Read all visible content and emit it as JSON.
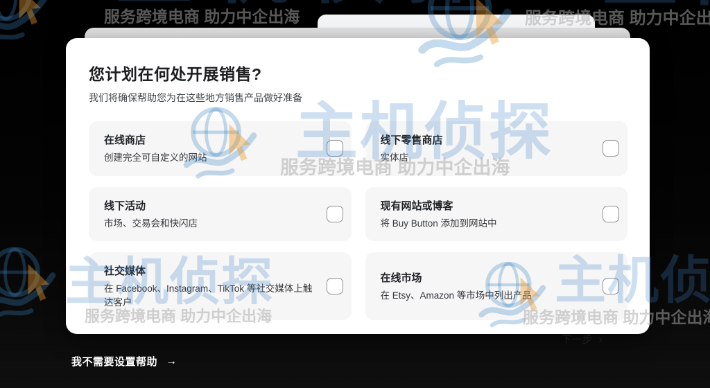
{
  "modal": {
    "title": "您计划在何处开展销售?",
    "subtitle": "我们将确保帮助您为在这些地方销售产品做好准备",
    "options": [
      {
        "title": "在线商店",
        "description": "创建完全可自定义的网站",
        "checked": false
      },
      {
        "title": "线下零售商店",
        "description": "实体店",
        "checked": false
      },
      {
        "title": "线下活动",
        "description": "市场、交易会和快闪店",
        "checked": false
      },
      {
        "title": "现有网站或博客",
        "description": "将 Buy Button 添加到网站中",
        "checked": false
      },
      {
        "title": "社交媒体",
        "description": "在 Facebook、Instagram、TikTok 等社交媒体上触达客户",
        "checked": false
      },
      {
        "title": "在线市场",
        "description": "在 Etsy、Amazon 等市场中列出产品",
        "checked": false
      }
    ],
    "next_label": "下一步",
    "next_chevron": "›"
  },
  "footer": {
    "skip_label": "我不需要设置帮助",
    "skip_arrow": "→"
  },
  "watermark": {
    "brand": "主机侦探",
    "tagline": "服务跨境电商  助力中企出海",
    "logo_icon": "globe-cursor-logo",
    "brand_color": "#3d83c5",
    "cursor_color": "#eb9828"
  },
  "colors": {
    "page_background": "#050505",
    "card_background": "#ffffff",
    "option_background": "#f6f6f7",
    "checkbox_border": "#8c9094",
    "text_primary": "#1b1d1f"
  }
}
